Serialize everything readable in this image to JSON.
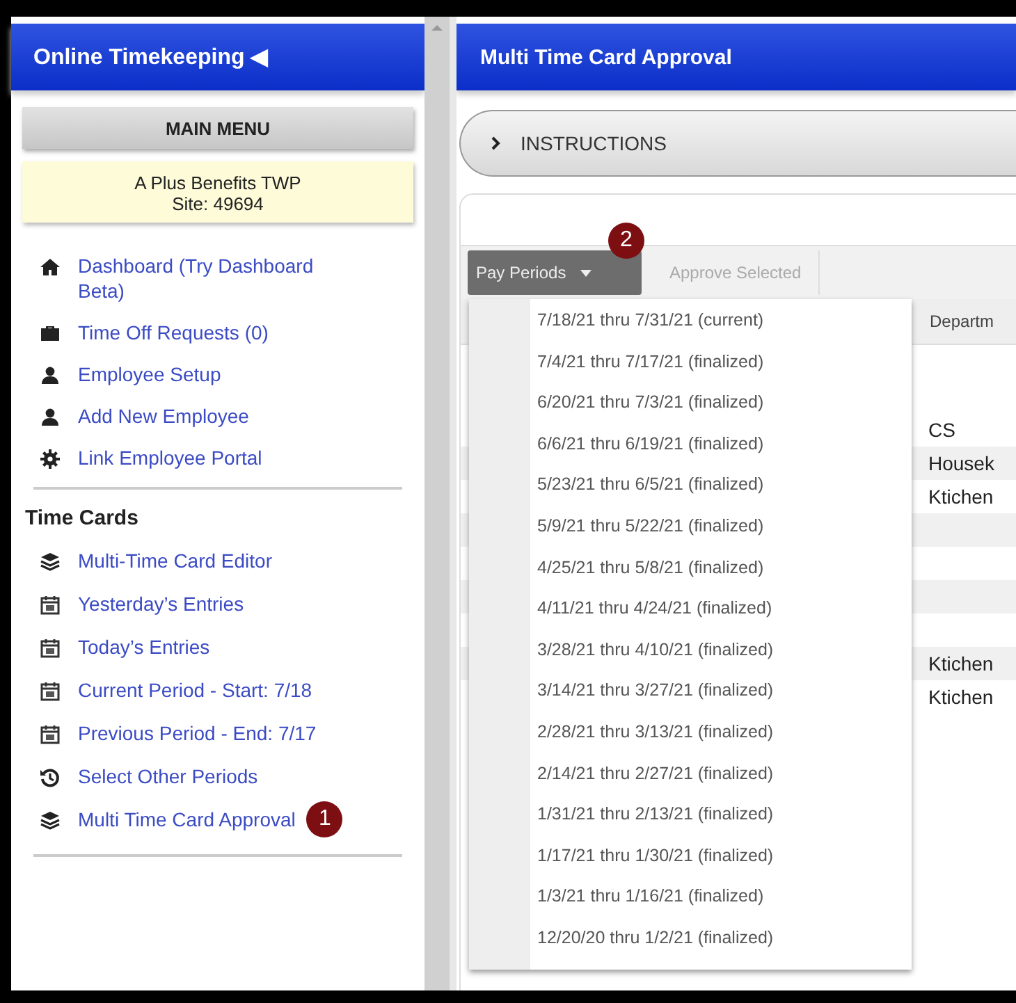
{
  "sidebar": {
    "title": "Online Timekeeping ◀",
    "menu_button": "MAIN MENU",
    "site": {
      "name": "A Plus Benefits TWP",
      "site_id": "Site: 49694"
    },
    "items": [
      {
        "label": "Dashboard (Try Dashboard Beta)"
      },
      {
        "label": "Time Off Requests (0)"
      },
      {
        "label": "Employee Setup"
      },
      {
        "label": "Add New Employee"
      },
      {
        "label": "Link Employee Portal"
      }
    ],
    "section": "Time Cards",
    "section_items": [
      {
        "label": "Multi-Time Card Editor"
      },
      {
        "label": "Yesterday’s Entries"
      },
      {
        "label": "Today’s Entries"
      },
      {
        "label": "Current Period - Start: 7/18"
      },
      {
        "label": "Previous Period - End: 7/17"
      },
      {
        "label": "Select Other Periods"
      },
      {
        "label": "Multi Time Card Approval",
        "callout": "1"
      }
    ]
  },
  "main": {
    "title": "Multi Time Card Approval",
    "instructions": "INSTRUCTIONS",
    "toolbar": {
      "pay_periods": "Pay Periods",
      "callout": "2",
      "approve": "Approve Selected",
      "approve_disabled": true
    },
    "pay_periods_menu": [
      "7/18/21 thru 7/31/21 (current)",
      "7/4/21 thru 7/17/21 (finalized)",
      "6/20/21 thru 7/3/21 (finalized)",
      "6/6/21 thru 6/19/21 (finalized)",
      "5/23/21 thru 6/5/21 (finalized)",
      "5/9/21 thru 5/22/21 (finalized)",
      "4/25/21 thru 5/8/21 (finalized)",
      "4/11/21 thru 4/24/21 (finalized)",
      "3/28/21 thru 4/10/21 (finalized)",
      "3/14/21 thru 3/27/21 (finalized)",
      "2/28/21 thru 3/13/21 (finalized)",
      "2/14/21 thru 2/27/21 (finalized)",
      "1/31/21 thru 2/13/21 (finalized)",
      "1/17/21 thru 1/30/21 (finalized)",
      "1/3/21 thru 1/16/21 (finalized)",
      "12/20/20 thru 1/2/21 (finalized)"
    ],
    "table": {
      "columns": [
        "Departm"
      ],
      "rows": [
        {
          "department": "CS"
        },
        {
          "department": "Housek"
        },
        {
          "department": "Ktichen"
        },
        {},
        {},
        {},
        {},
        {
          "department": "Ktichen"
        },
        {
          "department": "Ktichen"
        }
      ]
    }
  }
}
